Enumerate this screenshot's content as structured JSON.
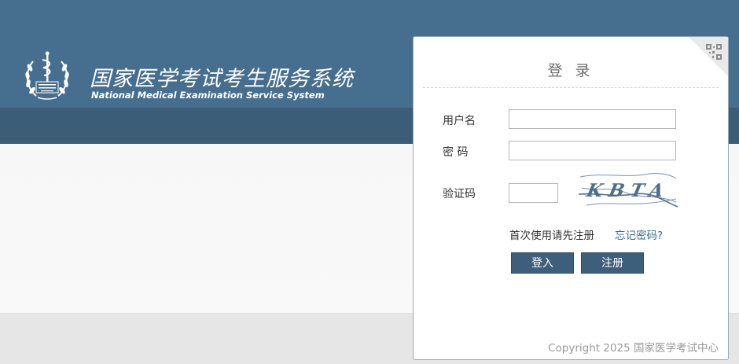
{
  "header": {
    "title": "国家医学考试考生服务系统",
    "subtitle": "National Medical Examination Service System",
    "emblem_icon": "medical-exam-emblem-icon"
  },
  "login": {
    "title": "登 录",
    "qr_icon": "qr-code-icon",
    "username_label": "用户名",
    "username_value": "",
    "password_label": "密 码",
    "password_value": "",
    "captcha_label": "验证码",
    "captcha_value": "",
    "captcha_text": "KBTA",
    "register_hint": "首次使用请先注册",
    "forgot_link": "忘记密码?",
    "login_button": "登入",
    "register_button": "注册",
    "copyright": "Copyright 2025 国家医学考试中心"
  },
  "colors": {
    "header": "#466e8f",
    "band": "#3c5d78",
    "button": "#3e5f7b",
    "link": "#3a6b97"
  }
}
